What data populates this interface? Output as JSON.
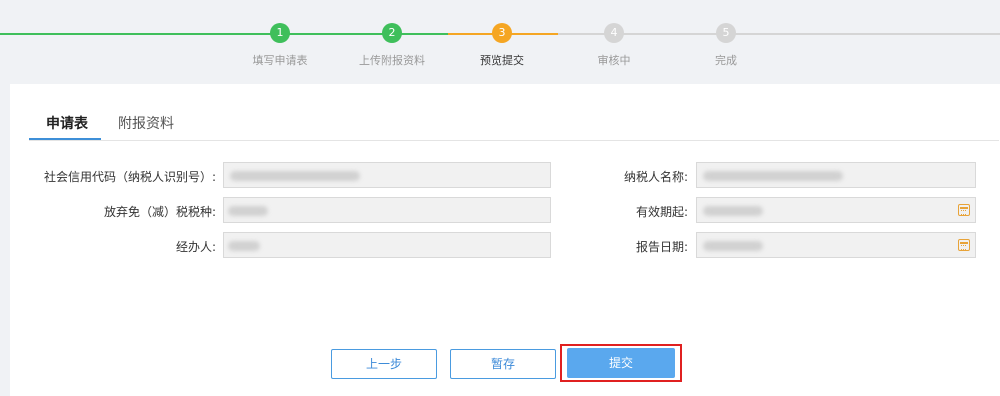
{
  "stepper": {
    "steps": [
      {
        "number": "1",
        "label": "填写申请表",
        "status": "done"
      },
      {
        "number": "2",
        "label": "上传附报资料",
        "status": "done"
      },
      {
        "number": "3",
        "label": "预览提交",
        "status": "current"
      },
      {
        "number": "4",
        "label": "审核中",
        "status": "pending"
      },
      {
        "number": "5",
        "label": "完成",
        "status": "pending"
      }
    ],
    "colors": {
      "done": "#3fbf5b",
      "current": "#f5a623",
      "pending": "#d5d5d5"
    }
  },
  "tabs": [
    {
      "label": "申请表",
      "active": true
    },
    {
      "label": "附报资料",
      "active": false
    }
  ],
  "form": {
    "credit_code_label": "社会信用代码（纳税人识别号）:",
    "taxpayer_name_label": "纳税人名称:",
    "exempt_tax_label": "放弃免（减）税税种:",
    "valid_from_label": "有效期起:",
    "handler_label": "经办人:",
    "report_date_label": "报告日期:"
  },
  "buttons": {
    "prev_label": "上一步",
    "save_label": "暂存",
    "submit_label": "提交"
  }
}
